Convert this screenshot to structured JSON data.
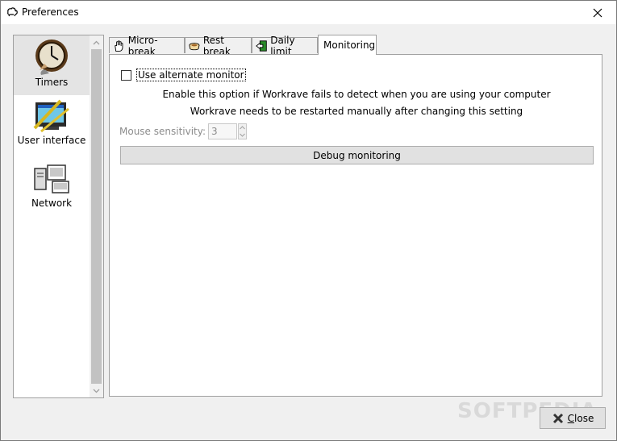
{
  "window": {
    "title": "Preferences"
  },
  "sidebar": {
    "items": [
      {
        "label": "Timers",
        "icon": "clock-icon",
        "selected": true
      },
      {
        "label": "User interface",
        "icon": "user-interface-icon",
        "selected": false
      },
      {
        "label": "Network",
        "icon": "network-icon",
        "selected": false
      }
    ]
  },
  "tabs": [
    {
      "label": "Micro-break",
      "icon": "hand-icon"
    },
    {
      "label": "Rest break",
      "icon": "cup-icon"
    },
    {
      "label": "Daily limit",
      "icon": "exit-icon"
    },
    {
      "label": "Monitoring",
      "icon": "",
      "active": true
    }
  ],
  "monitoring": {
    "alternate_monitor_label": "Use alternate monitor",
    "alternate_monitor_checked": false,
    "desc_line1": "Enable this option if Workrave fails to detect when you are using your computer",
    "desc_line2": "Workrave needs to be restarted manually after changing this setting",
    "sensitivity_label": "Mouse sensitivity:",
    "sensitivity_value": "3",
    "debug_button": "Debug monitoring"
  },
  "footer": {
    "close_label_first": "C",
    "close_label_rest": "lose"
  },
  "watermark": "SOFTPEDIA",
  "colors": {
    "panel_bg": "#ffffff",
    "window_bg": "#f0f0f0",
    "border": "#a0a0a0"
  }
}
